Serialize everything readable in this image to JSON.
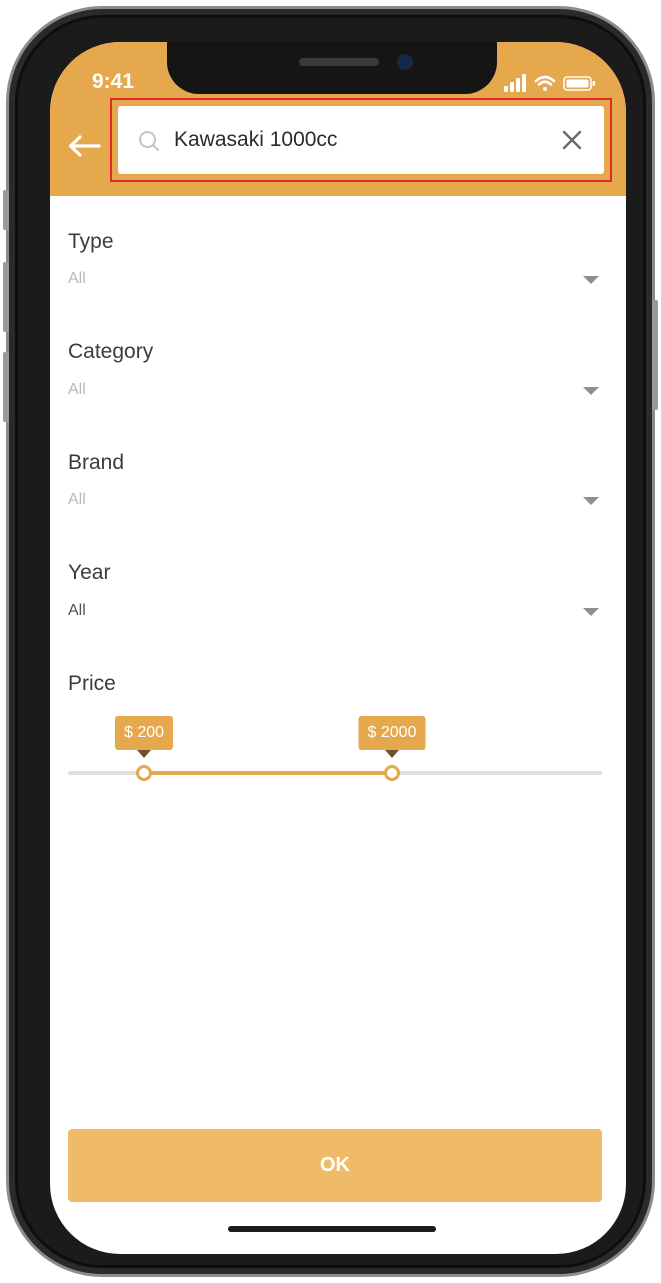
{
  "status_bar": {
    "time": "9:41"
  },
  "header": {
    "background_color": "#e6a84c",
    "back_icon": "arrow-left-icon",
    "search": {
      "value": "Kawasaki 1000cc",
      "search_icon": "search-icon",
      "clear_icon": "close-icon"
    }
  },
  "filters": [
    {
      "label": "Type",
      "value": "All"
    },
    {
      "label": "Category",
      "value": "All"
    },
    {
      "label": "Brand",
      "value": "All"
    },
    {
      "label": "Year",
      "value": "All"
    }
  ],
  "price": {
    "label": "Price",
    "min_label": "$ 200",
    "max_label": "$ 2000"
  },
  "ok_button": {
    "label": "OK",
    "color": "#f0bb68"
  }
}
